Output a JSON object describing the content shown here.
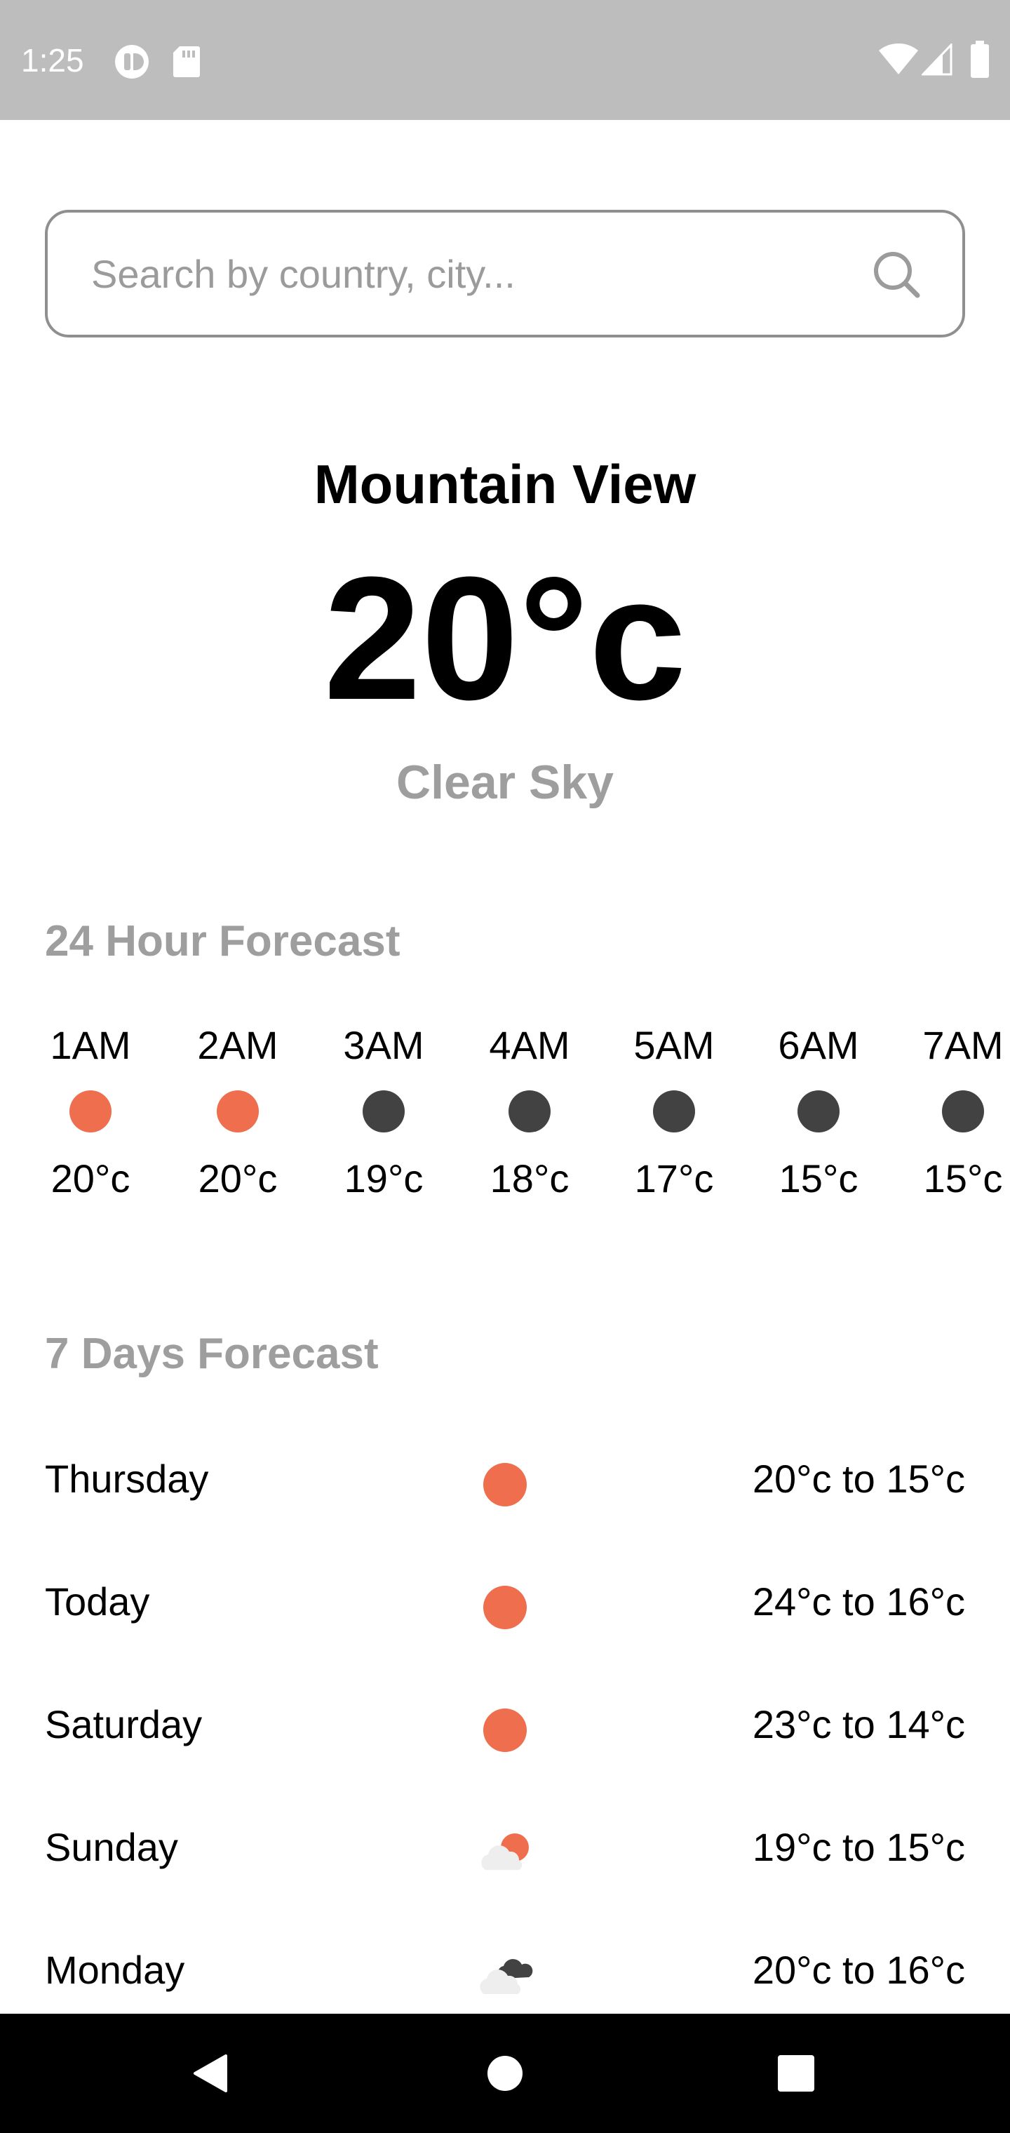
{
  "status_bar": {
    "time": "1:25",
    "icons": [
      "notification-app-icon",
      "sd-card-icon",
      "wifi-icon",
      "signal-icon",
      "battery-icon"
    ],
    "background": "#bdbdbd"
  },
  "search": {
    "placeholder": "Search by country, city...",
    "value": ""
  },
  "current": {
    "city": "Mountain View",
    "temperature": "20°c",
    "condition": "Clear Sky"
  },
  "hourly": {
    "title": "24 Hour Forecast",
    "items": [
      {
        "time": "1AM",
        "temp": "20°c",
        "icon": "sun-icon",
        "color": "#ee6e4e"
      },
      {
        "time": "2AM",
        "temp": "20°c",
        "icon": "sun-icon",
        "color": "#ee6e4e"
      },
      {
        "time": "3AM",
        "temp": "19°c",
        "icon": "moon-icon",
        "color": "#424242"
      },
      {
        "time": "4AM",
        "temp": "18°c",
        "icon": "moon-icon",
        "color": "#424242"
      },
      {
        "time": "5AM",
        "temp": "17°c",
        "icon": "moon-icon",
        "color": "#424242"
      },
      {
        "time": "6AM",
        "temp": "15°c",
        "icon": "moon-icon",
        "color": "#424242"
      },
      {
        "time": "7AM",
        "temp": "15°c",
        "icon": "moon-icon",
        "color": "#424242"
      }
    ]
  },
  "daily": {
    "title": "7 Days Forecast",
    "items": [
      {
        "day": "Thursday",
        "range": "20°c to 15°c",
        "icon": "sun-icon"
      },
      {
        "day": "Today",
        "range": "24°c to 16°c",
        "icon": "sun-icon"
      },
      {
        "day": "Saturday",
        "range": "23°c to 14°c",
        "icon": "sun-icon"
      },
      {
        "day": "Sunday",
        "range": "19°c to 15°c",
        "icon": "partly-cloudy-icon"
      },
      {
        "day": "Monday",
        "range": "20°c to 16°c",
        "icon": "cloudy-icon"
      }
    ]
  },
  "colors": {
    "sun": "#ee6e4e",
    "night": "#424242",
    "muted_text": "#9e9e9e",
    "cloud": "#eeeeee"
  },
  "nav_bar": {
    "buttons": [
      "back-icon",
      "home-icon",
      "recents-icon"
    ]
  }
}
